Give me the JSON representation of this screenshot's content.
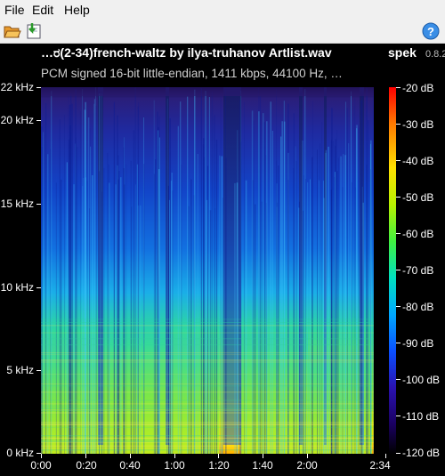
{
  "menu": {
    "file": "File",
    "edit": "Edit",
    "help": "Help"
  },
  "toolbar": {
    "open": "folder-open-icon",
    "save": "save-icon",
    "about": "help-icon"
  },
  "title": "…ರ(2-34)french-waltz by ilya-truhanov Artlist.wav",
  "app": {
    "name": "spek",
    "version": "0.8.2"
  },
  "info": "PCM signed 16-bit little-endian, 1411 kbps, 44100 Hz, …",
  "freq_labels": [
    "22 kHz",
    "20 kHz",
    "15 kHz",
    "10 kHz",
    "5 kHz",
    "0 kHz"
  ],
  "time_labels": [
    "0:00",
    "0:20",
    "0:40",
    "1:00",
    "1:20",
    "1:40",
    "2:00",
    "2:34"
  ],
  "db_labels": [
    "-20 dB",
    "-30 dB",
    "-40 dB",
    "-50 dB",
    "-60 dB",
    "-70 dB",
    "-80 dB",
    "-90 dB",
    "-100 dB",
    "-110 dB",
    "-120 dB"
  ],
  "colors": {
    "bg": "#000000",
    "menu_bg": "#f0f0f0",
    "text": "#ffffff",
    "low": "#1a0060",
    "mid": "#00c8ff",
    "high": "#ffd800"
  },
  "chart_data": {
    "type": "heatmap",
    "xlabel": "",
    "ylabel": "",
    "x_range_seconds": [
      0,
      154
    ],
    "y_range_khz": [
      0,
      22
    ],
    "z_range_db": [
      -120,
      -20
    ],
    "x_ticks": [
      "0:00",
      "0:20",
      "0:40",
      "1:00",
      "1:20",
      "1:40",
      "2:00",
      "2:34"
    ],
    "y_ticks": [
      "0 kHz",
      "5 kHz",
      "10 kHz",
      "15 kHz",
      "20 kHz",
      "22 kHz"
    ],
    "colorbar_ticks": [
      "-20 dB",
      "-30 dB",
      "-40 dB",
      "-50 dB",
      "-60 dB",
      "-70 dB",
      "-80 dB",
      "-90 dB",
      "-100 dB",
      "-110 dB",
      "-120 dB"
    ]
  }
}
